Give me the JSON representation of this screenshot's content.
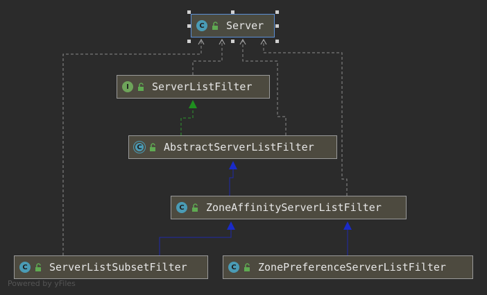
{
  "diagram": {
    "nodes": [
      {
        "id": "server",
        "label": "Server",
        "kind": "class",
        "icon": "class-icon",
        "selected": true
      },
      {
        "id": "server-list-filter",
        "label": "ServerListFilter",
        "kind": "interface",
        "icon": "interface-icon"
      },
      {
        "id": "abstract-server-list-filter",
        "label": "AbstractServerListFilter",
        "kind": "abstract",
        "icon": "abstract-class-icon"
      },
      {
        "id": "zone-affinity-server-list-filter",
        "label": "ZoneAffinityServerListFilter",
        "kind": "class",
        "icon": "class-icon"
      },
      {
        "id": "server-list-subset-filter",
        "label": "ServerListSubsetFilter",
        "kind": "class",
        "icon": "class-icon"
      },
      {
        "id": "zone-preference-server-list-filter",
        "label": "ZonePreferenceServerListFilter",
        "kind": "class",
        "icon": "class-icon"
      }
    ],
    "relations": [
      {
        "from": "server-list-filter",
        "to": "server",
        "type": "dependency"
      },
      {
        "from": "abstract-server-list-filter",
        "to": "server",
        "type": "dependency"
      },
      {
        "from": "zone-affinity-server-list-filter",
        "to": "server",
        "type": "dependency"
      },
      {
        "from": "server-list-subset-filter",
        "to": "server",
        "type": "dependency"
      },
      {
        "from": "abstract-server-list-filter",
        "to": "server-list-filter",
        "type": "implements"
      },
      {
        "from": "zone-affinity-server-list-filter",
        "to": "abstract-server-list-filter",
        "type": "extends"
      },
      {
        "from": "server-list-subset-filter",
        "to": "zone-affinity-server-list-filter",
        "type": "extends"
      },
      {
        "from": "zone-preference-server-list-filter",
        "to": "zone-affinity-server-list-filter",
        "type": "extends"
      }
    ],
    "icon_glyphs": {
      "class": "C",
      "interface": "I",
      "abstract": "C"
    },
    "colors": {
      "background": "#2b2b2b",
      "node_fill": "#4d4a3f",
      "node_border": "#9a9a9a",
      "selected_border": "#5b8fd6",
      "dependency_line": "#8c8c8c",
      "implements_line": "#2f9a2f",
      "extends_line": "#1f2aa8",
      "lock": "#5faa52"
    }
  },
  "watermark": "Powered by yFiles"
}
